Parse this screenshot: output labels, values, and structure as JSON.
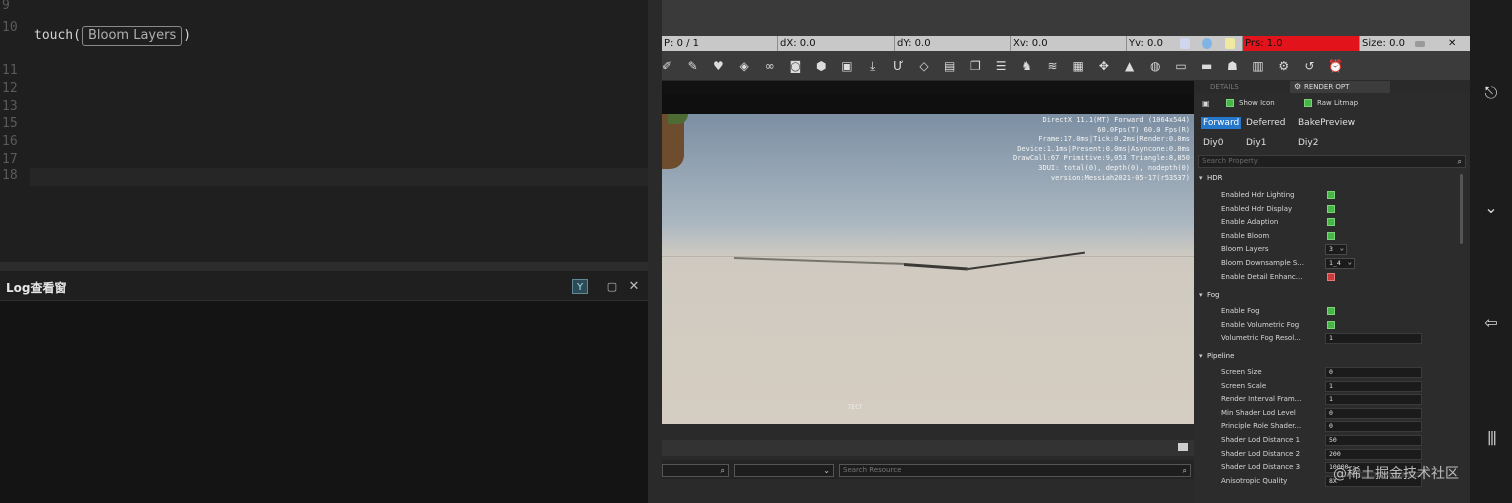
{
  "editor": {
    "lines": [
      {
        "num": "9",
        "code": ""
      },
      {
        "num": "10",
        "code_prefix": "touch(",
        "hint": "Bloom Layers",
        "code_suffix": ")"
      },
      {
        "num": "11",
        "code": ""
      },
      {
        "num": "12",
        "code": ""
      },
      {
        "num": "13",
        "code": ""
      },
      {
        "num": "15",
        "code": ""
      },
      {
        "num": "16",
        "code": ""
      },
      {
        "num": "17",
        "code": ""
      },
      {
        "num": "18",
        "code": ""
      }
    ]
  },
  "log_panel": {
    "title": "Log查看窗",
    "pin_icon": "pin-icon",
    "maximize_icon": "maximize-icon",
    "close_icon": "close-icon",
    "max_glyph": "▢",
    "close_glyph": "✕",
    "pin_glyph": "Y"
  },
  "statusbar": {
    "p": "P: 0 / 1",
    "dx": "dX: 0.0",
    "dy": "dY: 0.0",
    "xv": "Xv: 0.0",
    "yv": "Yv: 0.0",
    "prs": "Prs: 1.0",
    "size": "Size: 0.0",
    "close_glyph": "✕",
    "prs_color": "#e3131b"
  },
  "toolbar": {
    "icons": [
      "brush-icon",
      "brush-alt-icon",
      "heart-icon",
      "bucket-icon",
      "link-icon",
      "camera-icon",
      "hexagon-icon",
      "image-icon",
      "download-icon",
      "magnet-icon",
      "cube-icon",
      "layers-icon",
      "copy-icon",
      "list-icon",
      "figure-icon",
      "stack-icon",
      "document-icon",
      "puzzle-icon",
      "warning-icon",
      "globe-icon",
      "monitor-icon",
      "display-icon",
      "robot-icon",
      "notes-icon",
      "gear-icon",
      "history-icon",
      "alarm-icon"
    ],
    "glyphs": [
      "✐",
      "✎",
      "♥",
      "◈",
      "∞",
      "◙",
      "⬢",
      "▣",
      "⤓",
      "Ư",
      "◇",
      "▤",
      "❐",
      "☰",
      "♞",
      "≋",
      "▦",
      "✥",
      "▲",
      "◍",
      "▭",
      "▬",
      "☗",
      "▥",
      "⚙",
      "↺",
      "⏰"
    ]
  },
  "viewport": {
    "debug_lines": [
      "DirectX 11.1(MT) Forward (1064x544)",
      "60.0Fps(T) 60.0 Fps(R)",
      "Frame:17.0ms|Tick:0.2ms|Render:0.0ms",
      "Device:1.1ms|Present:0.0ms|Asyncone:0.0ms",
      "DrawCall:67 Primitive:9,053 Triangle:8,850",
      "3DUI: total(0), depth(0), nodepth(0)",
      "version:Messiah2021-05-17(r53537)"
    ],
    "center_label": "ТЕСТ"
  },
  "resource_bar": {
    "search_placeholder": "Search Resource",
    "arrow": "⌄",
    "search_glyph": "⌕"
  },
  "panel": {
    "tabs": [
      {
        "label": "DETAILS",
        "active": false
      },
      {
        "label": "RENDER OPT",
        "active": true
      }
    ],
    "save_glyph": "💾",
    "show_icon_label": "Show Icon",
    "raw_litmap_label": "Raw Litmap",
    "modes_row1": [
      "Forward",
      "Deferred",
      "BakePreview"
    ],
    "modes_row2": [
      "Diy0",
      "Diy1",
      "Diy2"
    ],
    "selected_mode": "Forward",
    "search_placeholder": "Search Property",
    "search_glyph": "⌕",
    "sections": {
      "hdr": "HDR",
      "fog": "Fog",
      "pipeline": "Pipeline"
    },
    "hdr_props": [
      {
        "label": "Enabled Hdr Lighting",
        "type": "check",
        "value": true
      },
      {
        "label": "Enabled Hdr Display",
        "type": "check",
        "value": true
      },
      {
        "label": "Enable Adaption",
        "type": "check",
        "value": true
      },
      {
        "label": "Enable Bloom",
        "type": "check",
        "value": true
      },
      {
        "label": "Bloom Layers",
        "type": "drop",
        "value": "3"
      },
      {
        "label": "Bloom Downsample S...",
        "type": "drop",
        "value": "1_4"
      },
      {
        "label": "Enable Detail Enhanc...",
        "type": "check",
        "value": false
      }
    ],
    "fog_props": [
      {
        "label": "Enable Fog",
        "type": "check",
        "value": true
      },
      {
        "label": "Enable Volumetric Fog",
        "type": "check",
        "value": true
      },
      {
        "label": "Volumetric Fog Resol...",
        "type": "text",
        "value": "1"
      }
    ],
    "pipeline_props": [
      {
        "label": "Screen Size",
        "value": "0"
      },
      {
        "label": "Screen Scale",
        "value": "1"
      },
      {
        "label": "Render Interval Fram...",
        "value": "1"
      },
      {
        "label": "Min Shader Lod Level",
        "value": "0"
      },
      {
        "label": "Principle Role Shader...",
        "value": "0"
      },
      {
        "label": "Shader Lod Distance 1",
        "value": "50"
      },
      {
        "label": "Shader Lod Distance 2",
        "value": "200"
      },
      {
        "label": "Shader Lod Distance 3",
        "value": "10000"
      },
      {
        "label": "Anisotropic Quality",
        "value": "8X"
      }
    ],
    "checked_color": "#48b548",
    "unchecked_color": "#cc3b3b",
    "selected_color": "#2577c9"
  },
  "rightbar": {
    "icons": [
      "exit-icon",
      "chevron-down-icon",
      "back-arrow-icon",
      "menu-bars-icon"
    ],
    "glyphs": [
      "⎋",
      "⌄",
      "⇦",
      "|||"
    ]
  },
  "watermark": "@稀土掘金技术社区"
}
